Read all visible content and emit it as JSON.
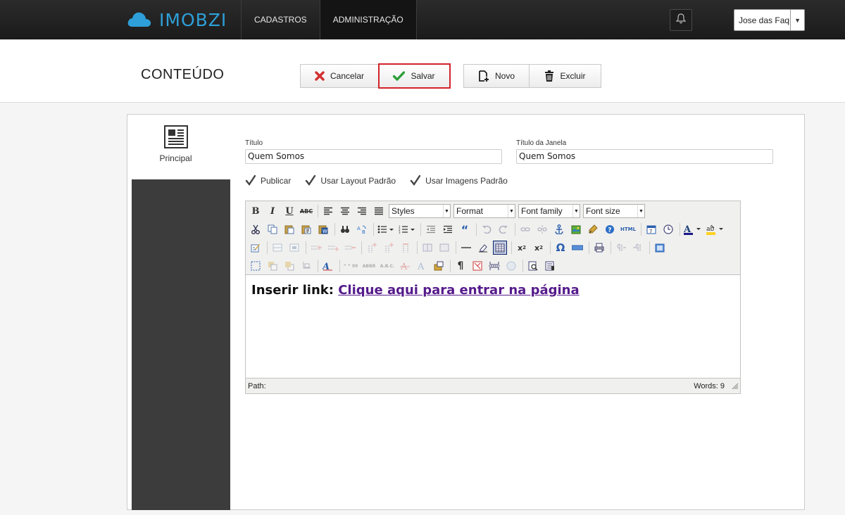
{
  "app": {
    "logo_text": "IMOBZI",
    "brand_color": "#2e9fd8"
  },
  "nav": {
    "items": [
      {
        "label": "CADASTROS"
      },
      {
        "label": "ADMINISTRAÇÃO"
      }
    ]
  },
  "user": {
    "name": "Jose das Faq",
    "caret": "▼"
  },
  "page": {
    "title": "CONTEÚDO"
  },
  "actions": {
    "cancel": "Cancelar",
    "save": "Salvar",
    "new": "Novo",
    "delete": "Excluir"
  },
  "tabs": {
    "main": "Principal"
  },
  "form": {
    "title_label": "Título",
    "title_value": "Quem Somos",
    "window_title_label": "Título da Janela",
    "window_title_value": "Quem Somos",
    "checks": [
      {
        "label": "Publicar",
        "checked": true
      },
      {
        "label": "Usar Layout Padrão",
        "checked": true
      },
      {
        "label": "Usar Imagens Padrão",
        "checked": true
      }
    ]
  },
  "editor": {
    "selects": {
      "styles": "Styles",
      "format": "Format",
      "font_family": "Font family",
      "font_size": "Font size"
    },
    "content_prefix": "Inserir link: ",
    "content_link": "Clique aqui para entrar na página",
    "path_label": "Path:",
    "words_label": "Words: 9"
  }
}
